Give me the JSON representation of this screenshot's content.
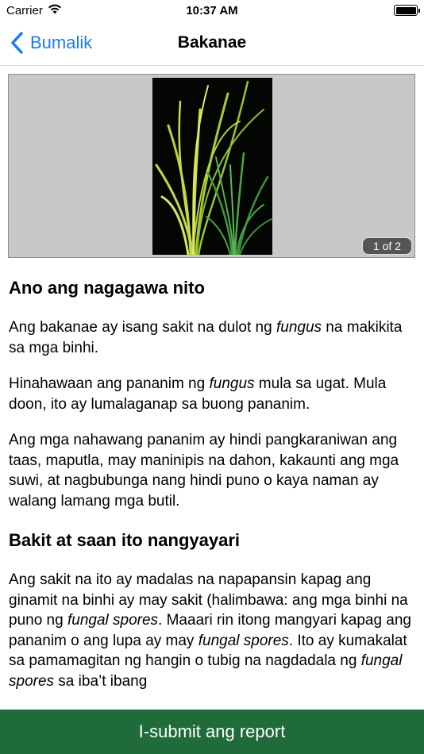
{
  "status_bar": {
    "carrier": "Carrier",
    "time": "10:37 AM",
    "battery_level": 1.0
  },
  "nav": {
    "back_label": "Bumalik",
    "title": "Bakanae"
  },
  "gallery": {
    "counter": "1 of 2"
  },
  "sections": {
    "s1_heading": "Ano ang nagagawa nito",
    "s1_p1_a": "Ang bakanae ay isang sakit na dulot ng ",
    "s1_p1_b": "fungus",
    "s1_p1_c": " na makikita sa mga binhi.",
    "s1_p2_a": "Hinahawaan ang pananim ng ",
    "s1_p2_b": "fungus",
    "s1_p2_c": " mula sa ugat. Mula doon, ito ay lumalaganap sa buong pananim.",
    "s1_p3": "Ang mga nahawang pananim ay hindi pangkaraniwan ang taas, maputla, may maninipis na dahon, kakaunti ang mga suwi, at nagbubunga nang hindi puno o kaya naman ay walang lamang mga butil.",
    "s2_heading": "Bakit at saan ito nangyayari",
    "s2_p1_a": "Ang sakit na ito ay madalas na napapansin kapag ang ginamit na binhi ay may sakit (halimbawa: ang mga binhi na puno ng ",
    "s2_p1_b": "fungal spores",
    "s2_p1_c": ". Maaari rin itong mangyari kapag ang pananim o ang lupa ay may ",
    "s2_p1_d": "fungal spores",
    "s2_p1_e": ". Ito ay kumakalat sa pamamagitan ng hangin o tubig na nagdadala ng ",
    "s2_p1_f": "fungal spores",
    "s2_p1_g": " sa iba’t ibang"
  },
  "submit_button": "I-submit ang report"
}
